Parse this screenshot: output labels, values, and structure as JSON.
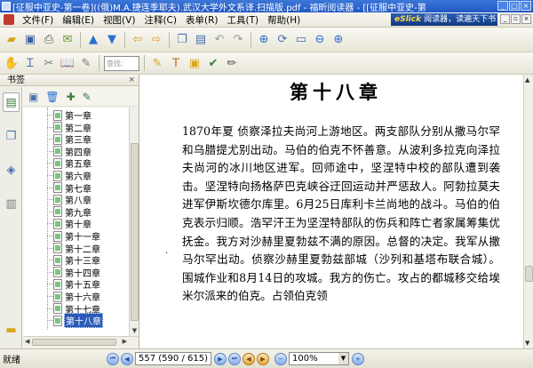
{
  "window": {
    "title": "[征服中亚史-第一卷]((俄)M.A.捷连季耶夫).武汉大学外文系译.扫描版.pdf - 福昕阅读器 - [[征服中亚史-第"
  },
  "menu": [
    "文件(F)",
    "编辑(E)",
    "视图(V)",
    "注释(C)",
    "表单(R)",
    "工具(T)",
    "帮助(H)"
  ],
  "promo": {
    "brand": "eSlick",
    "text": "阅读器，读遍天下书！"
  },
  "toolbar1": {
    "icons": [
      "open-folder-icon",
      "save-icon",
      "print-icon",
      "email-icon",
      "nav-up-icon",
      "nav-down-icon",
      "back-arrow-icon",
      "forward-arrow-icon",
      "extract-page-icon",
      "page-icon",
      "undo-icon",
      "redo-icon",
      "zoom-tool-icon",
      "rotate-icon",
      "fit-page-icon",
      "zoom-out-icon",
      "zoom-in-icon"
    ]
  },
  "toolbar2": {
    "zoom_placeholder": "查找:"
  },
  "sidebar": {
    "header": "书签",
    "close_label": "×",
    "bookmarks": [
      "第一章",
      "第二章",
      "第三章",
      "第四章",
      "第五章",
      "第六章",
      "第七章",
      "第八章",
      "第九章",
      "第十章",
      "第十一章",
      "第十二章",
      "第十三章",
      "第十四章",
      "第十五章",
      "第十六章",
      "第十七章",
      "第十八章"
    ],
    "selected_index": 17
  },
  "document": {
    "chapter_title": "第十八章",
    "paragraph": "1870年夏 侦察泽拉夫尚河上游地区。两支部队分别从撒马尔罕和乌腊提尤别出动。马伯的伯克不怀善意。从波利多拉克向泽拉夫尚河的冰川地区进军。回师途中，坚涅特中校的部队遭到袭击。坚涅特向扬格萨巴克峡谷迂回运动并严惩敌人。阿勃拉莫夫进军伊斯坎德尔库里。6月25日库利卡兰尚地的战斗。马伯的伯克表示归顺。浩罕汗王为坚涅特部队的伤兵和阵亡者家属筹集优抚金。我方对沙赫里夏勃兹不满的原因。总督的决定。我军从撒马尔罕出动。侦察沙赫里夏勃兹部城（沙列和基塔布联合城）。围城作业和8月14日的攻城。我方的伤亡。攻占的都城移交给埃米尔派来的伯克。占领伯克领"
  },
  "status": {
    "text": "就绪",
    "current_page": "557",
    "page_total": "(590 / 615)",
    "zoom": "100%"
  }
}
